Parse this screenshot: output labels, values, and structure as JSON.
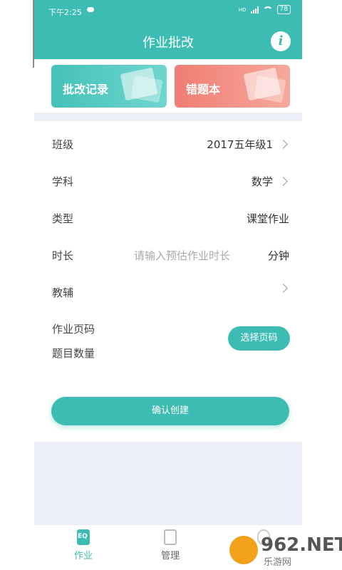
{
  "status_bar": {
    "time": "下午2:25",
    "network": "HD",
    "battery": "78"
  },
  "header": {
    "title": "作业批改",
    "info_icon": "info-icon"
  },
  "cards": [
    {
      "label": "批改记录",
      "color": "#44c1b9"
    },
    {
      "label": "错题本",
      "color": "#f07d73"
    }
  ],
  "form": {
    "class_label": "班级",
    "class_value": "2017五年级1",
    "subject_label": "学科",
    "subject_value": "数学",
    "type_label": "类型",
    "type_value": "课堂作业",
    "duration_label": "时长",
    "duration_placeholder": "请输入预估作业时长",
    "duration_unit": "分钟",
    "tutor_label": "教辅",
    "page_label": "作业页码",
    "count_label": "题目数量",
    "select_page_button": "选择页码"
  },
  "confirm_button": "确认创建",
  "tabs": [
    {
      "label": "作业",
      "active": true
    },
    {
      "label": "管理",
      "active": false
    }
  ],
  "watermark": {
    "text": "962.NET",
    "sub": "乐游网"
  },
  "colors": {
    "accent": "#3dbcb4",
    "background_gray": "#eceef8"
  }
}
